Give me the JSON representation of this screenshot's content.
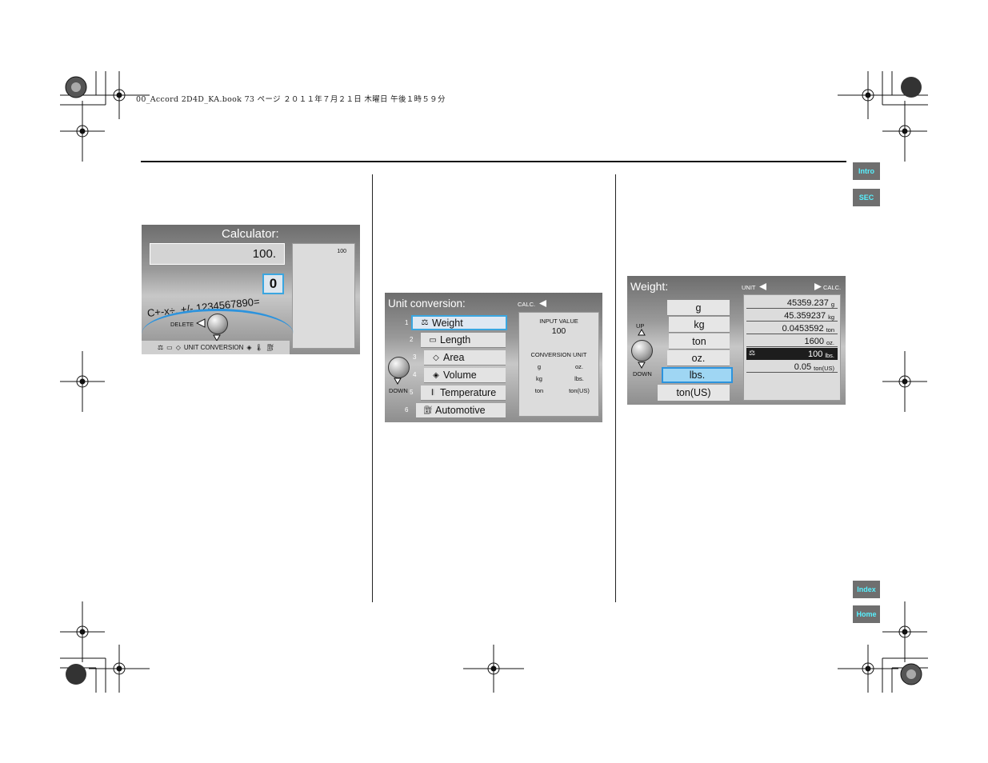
{
  "book_info": "00_Accord 2D4D_KA.book  73 ページ  ２０１１年７月２１日  木曜日  午後１時５９分",
  "nav": {
    "intro": "Intro",
    "sec": "SEC",
    "index": "Index",
    "home": "Home"
  },
  "calculator": {
    "title": "Calculator:",
    "display_value": "100.",
    "history_value": "100",
    "selected_key": "0",
    "keys": "C+-x÷. +/- 1234567890=",
    "delete_label": "DELETE",
    "bottom_bar": "UNIT CONVERSION"
  },
  "unit_conversion": {
    "title": "Unit conversion:",
    "calc_label": "CALC.",
    "down_label": "DOWN",
    "items": [
      {
        "num": "1",
        "label": "Weight",
        "icon": "weight-icon"
      },
      {
        "num": "2",
        "label": "Length",
        "icon": "ruler-icon"
      },
      {
        "num": "3",
        "label": "Area",
        "icon": "area-icon"
      },
      {
        "num": "4",
        "label": "Volume",
        "icon": "volume-icon"
      },
      {
        "num": "5",
        "label": "Temperature",
        "icon": "thermometer-icon"
      },
      {
        "num": "6",
        "label": "Automotive",
        "icon": "fuel-icon"
      }
    ],
    "input_value_label": "INPUT VALUE",
    "input_value": "100",
    "conversion_unit_label": "CONVERSION UNIT",
    "units": [
      [
        "g",
        "oz."
      ],
      [
        "kg",
        "lbs."
      ],
      [
        "ton",
        "ton(US)"
      ]
    ]
  },
  "weight": {
    "title": "Weight:",
    "unit_label": "UNIT",
    "calc_label": "CALC.",
    "up_label": "UP",
    "down_label": "DOWN",
    "units": [
      "g",
      "kg",
      "ton",
      "oz.",
      "lbs.",
      "ton(US)"
    ],
    "selected_unit": "lbs.",
    "results": [
      {
        "value": "45359.237",
        "unit": "g"
      },
      {
        "value": "45.359237",
        "unit": "kg"
      },
      {
        "value": "0.0453592",
        "unit": "ton"
      },
      {
        "value": "1600",
        "unit": "oz."
      },
      {
        "value": "100",
        "unit": "lbs."
      },
      {
        "value": "0.05",
        "unit": "ton(US)"
      }
    ]
  },
  "colors": {
    "accent_blue": "#2c93dd",
    "tab_bg": "#6f6f6f",
    "tab_text": "#57f1ff"
  }
}
